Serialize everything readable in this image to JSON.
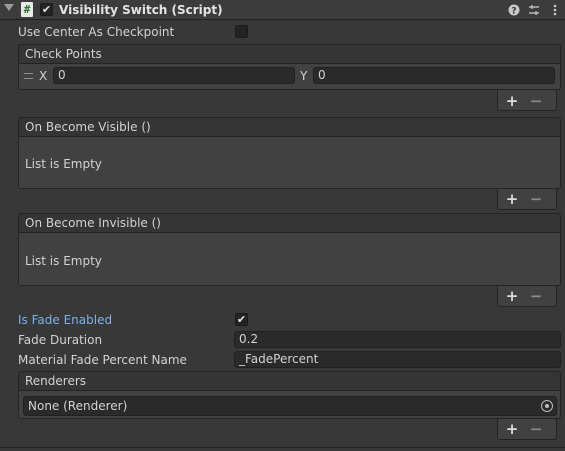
{
  "component": {
    "title": "Visibility Switch (Script)",
    "script_icon_glyph": "#",
    "enabled": true,
    "icons": [
      "help-icon",
      "preset-icon",
      "more-icon"
    ]
  },
  "fields": {
    "use_center_label": "Use Center As Checkpoint",
    "use_center_value": false,
    "is_fade_label": "Is Fade Enabled",
    "is_fade_value": true,
    "fade_duration_label": "Fade Duration",
    "fade_duration_value": "0.2",
    "material_fade_label": "Material Fade Percent Name",
    "material_fade_value": "_FadePercent"
  },
  "check_points": {
    "header": "Check Points",
    "x_label": "X",
    "x_value": "0",
    "y_label": "Y",
    "y_value": "0"
  },
  "on_become_visible": {
    "header": "On Become Visible ()",
    "empty": "List is Empty"
  },
  "on_become_invisible": {
    "header": "On Become Invisible ()",
    "empty": "List is Empty"
  },
  "renderers": {
    "header": "Renderers",
    "item": "None (Renderer)"
  },
  "list_buttons": {
    "add": "+",
    "remove": "−"
  },
  "colors": {
    "background": "#383838",
    "field_bg": "#2a2a2a",
    "modified_label": "#7ab1ee"
  }
}
